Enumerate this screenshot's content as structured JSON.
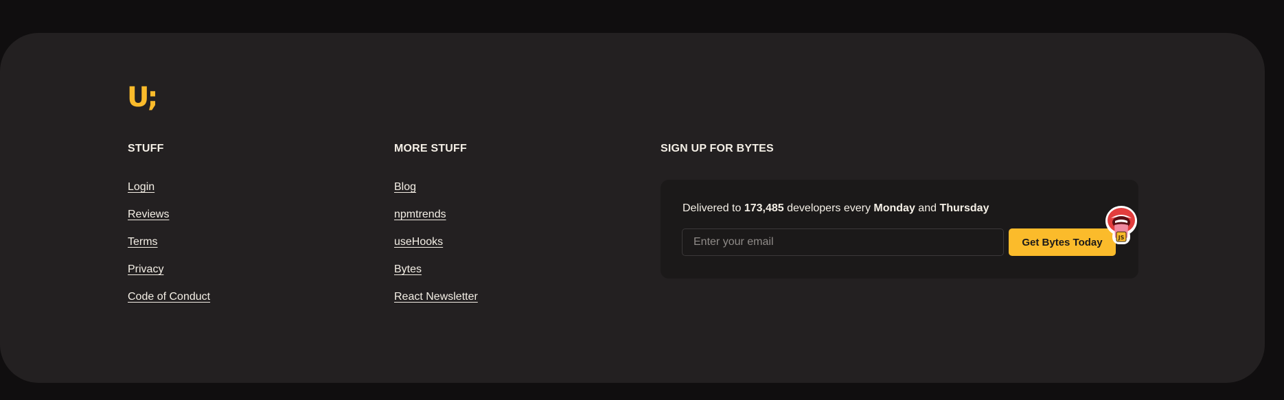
{
  "brand": {
    "logo_text": "U;",
    "accent_color": "#fbbb2b"
  },
  "stuff": {
    "heading": "STUFF",
    "links": [
      "Login",
      "Reviews",
      "Terms",
      "Privacy",
      "Code of Conduct"
    ]
  },
  "more_stuff": {
    "heading": "MORE STUFF",
    "links": [
      "Blog",
      "npmtrends",
      "useHooks",
      "Bytes",
      "React Newsletter"
    ]
  },
  "signup": {
    "heading": "SIGN UP FOR BYTES",
    "tagline_prefix": "Delivered to ",
    "subscriber_count": "173,485",
    "tagline_middle": " developers every ",
    "day_one": "Monday",
    "tagline_and": " and ",
    "day_two": "Thursday",
    "email_placeholder": "Enter your email",
    "button_label": "Get Bytes Today",
    "mascot_icon": "mouth-tongue-sticker-icon"
  }
}
